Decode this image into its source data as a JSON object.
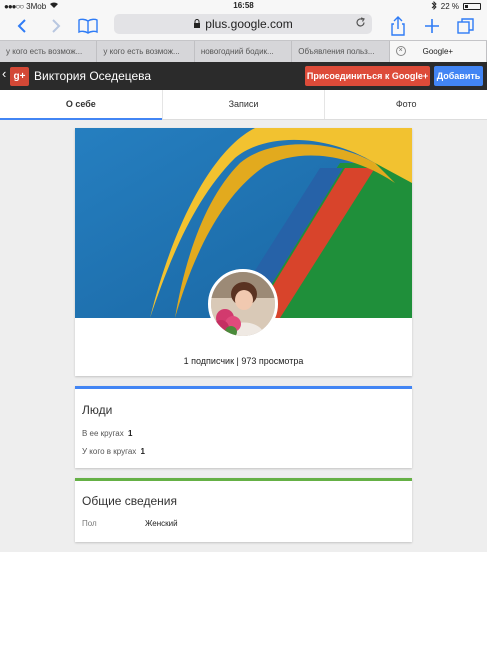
{
  "statusbar": {
    "carrier": "3Mob",
    "time": "16:58",
    "battery": "22 %",
    "battery_level": 0.22
  },
  "browser": {
    "url": "plus.google.com",
    "tabs": [
      {
        "label": "у кого есть возмож..."
      },
      {
        "label": "у кого есть возмож..."
      },
      {
        "label": "новогодний бодик..."
      },
      {
        "label": "Объявления польз..."
      },
      {
        "label": "Google+"
      }
    ]
  },
  "header": {
    "logo": "g+",
    "profile_name": "Виктория Оседецева",
    "join_label": "Присоединиться к Google+",
    "add_label": "Добавить"
  },
  "profile_nav": {
    "tabs": [
      {
        "label": "О себе"
      },
      {
        "label": "Записи"
      },
      {
        "label": "Фото"
      }
    ]
  },
  "profile": {
    "stats": "1 подписчик | 973 просмотра"
  },
  "people": {
    "title": "Люди",
    "in_circles_label": "В ее кругах",
    "in_circles_value": "1",
    "have_in_circles_label": "У кого в кругах",
    "have_in_circles_value": "1"
  },
  "general": {
    "title": "Общие сведения",
    "gender_label": "Пол",
    "gender_value": "Женский"
  },
  "colors": {
    "join_button": "#dd4b39",
    "add_button": "#4285f4",
    "people_accent": "#4285f4",
    "general_accent": "#65b045"
  },
  "icons": {
    "back": "back-chevron-icon",
    "forward": "forward-chevron-icon",
    "bookmarks": "bookmarks-book-icon",
    "lock": "lock-icon",
    "reload": "reload-icon",
    "share": "share-icon",
    "new_tab": "plus-icon",
    "tabs": "tabs-icon"
  }
}
